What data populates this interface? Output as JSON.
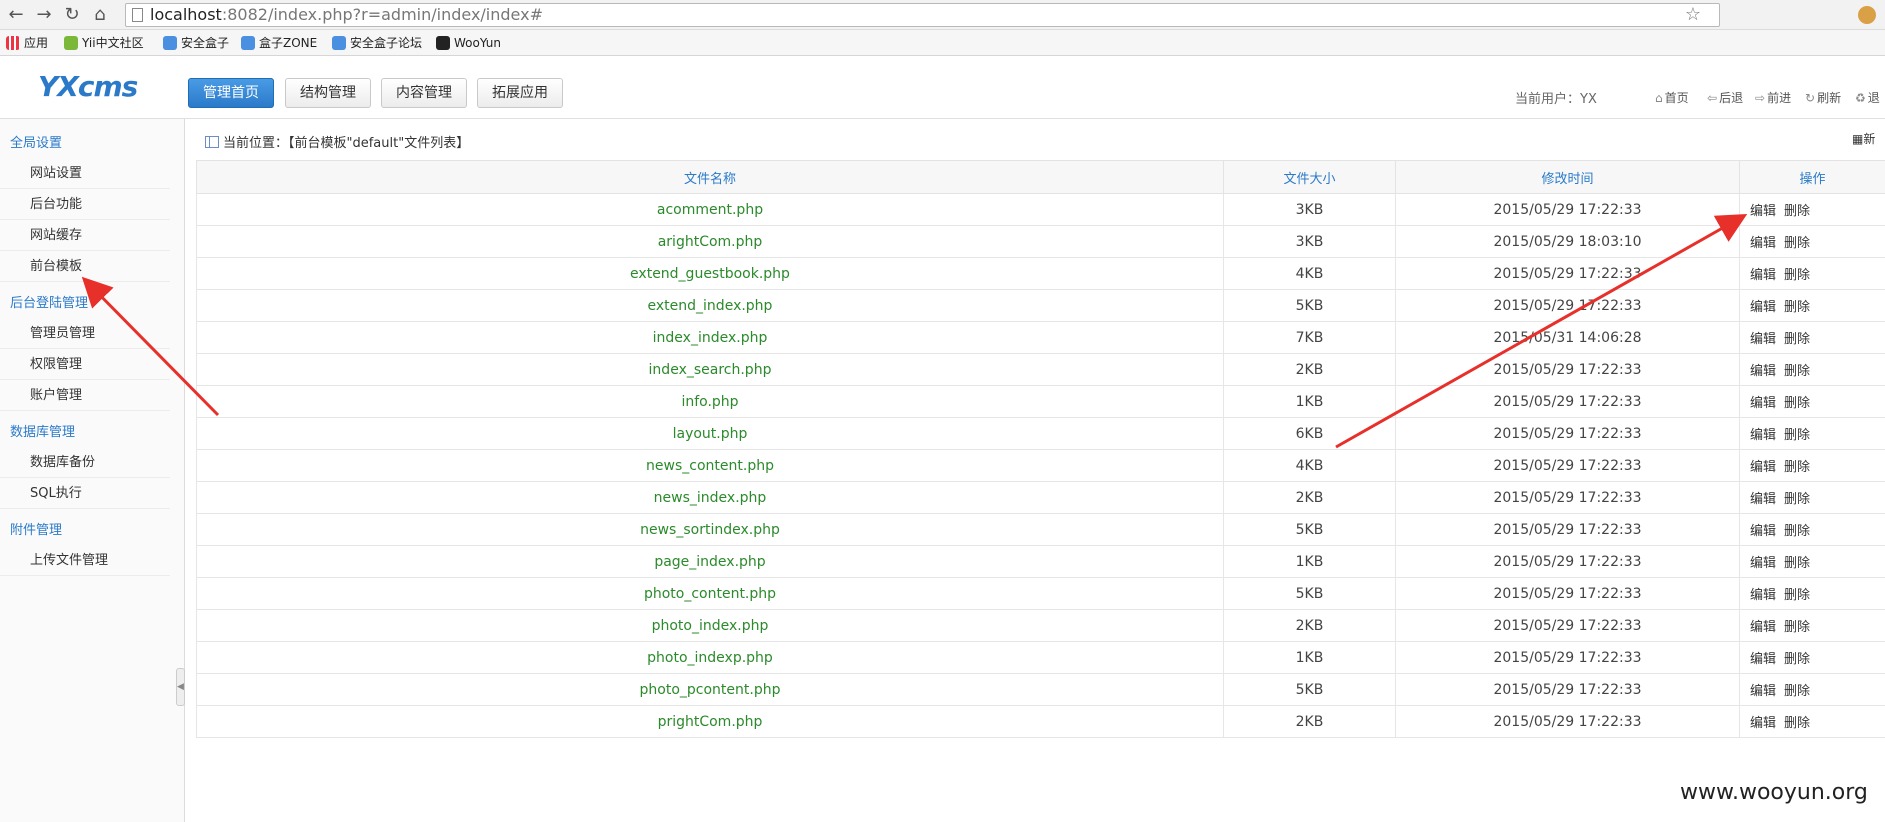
{
  "browser": {
    "url_host": "localhost",
    "url_path": ":8082/index.php?r=admin/index/index#",
    "bookmarks": [
      "应用",
      "Yii中文社区",
      "安全盒子",
      "盒子ZONE",
      "安全盒子论坛",
      "WooYun"
    ]
  },
  "header": {
    "logo": "YXcms",
    "tabs": [
      "管理首页",
      "结构管理",
      "内容管理",
      "拓展应用"
    ],
    "current_user": "当前用户：YX",
    "quick_links": [
      "首页",
      "后退",
      "前进",
      "刷新",
      "退"
    ]
  },
  "sidebar": {
    "groups": [
      {
        "title": "全局设置",
        "items": [
          "网站设置",
          "后台功能",
          "网站缓存",
          "前台模板"
        ]
      },
      {
        "title": "后台登陆管理",
        "items": [
          "管理员管理",
          "权限管理",
          "账户管理"
        ]
      },
      {
        "title": "数据库管理",
        "items": [
          "数据库备份",
          "SQL执行"
        ]
      },
      {
        "title": "附件管理",
        "items": [
          "上传文件管理"
        ]
      }
    ]
  },
  "breadcrumb": "当前位置：【前台模板\"default\"文件列表】",
  "new_label": "新",
  "table": {
    "headers": [
      "文件名称",
      "文件大小",
      "修改时间",
      "操作"
    ],
    "edit_label": "编辑",
    "delete_label": "删除",
    "rows": [
      [
        "acomment.php",
        "3KB",
        "2015/05/29 17:22:33"
      ],
      [
        "arightCom.php",
        "3KB",
        "2015/05/29 18:03:10"
      ],
      [
        "extend_guestbook.php",
        "4KB",
        "2015/05/29 17:22:33"
      ],
      [
        "extend_index.php",
        "5KB",
        "2015/05/29 17:22:33"
      ],
      [
        "index_index.php",
        "7KB",
        "2015/05/31 14:06:28"
      ],
      [
        "index_search.php",
        "2KB",
        "2015/05/29 17:22:33"
      ],
      [
        "info.php",
        "1KB",
        "2015/05/29 17:22:33"
      ],
      [
        "layout.php",
        "6KB",
        "2015/05/29 17:22:33"
      ],
      [
        "news_content.php",
        "4KB",
        "2015/05/29 17:22:33"
      ],
      [
        "news_index.php",
        "2KB",
        "2015/05/29 17:22:33"
      ],
      [
        "news_sortindex.php",
        "5KB",
        "2015/05/29 17:22:33"
      ],
      [
        "page_index.php",
        "1KB",
        "2015/05/29 17:22:33"
      ],
      [
        "photo_content.php",
        "5KB",
        "2015/05/29 17:22:33"
      ],
      [
        "photo_index.php",
        "2KB",
        "2015/05/29 17:22:33"
      ],
      [
        "photo_indexp.php",
        "1KB",
        "2015/05/29 17:22:33"
      ],
      [
        "photo_pcontent.php",
        "5KB",
        "2015/05/29 17:22:33"
      ],
      [
        "prightCom.php",
        "2KB",
        "2015/05/29 17:22:33"
      ]
    ]
  },
  "watermark": "www.wooyun.org",
  "colors": {
    "accent": "#2a7ac9",
    "filename": "#2b8a2b",
    "arrow": "#e8302b"
  }
}
